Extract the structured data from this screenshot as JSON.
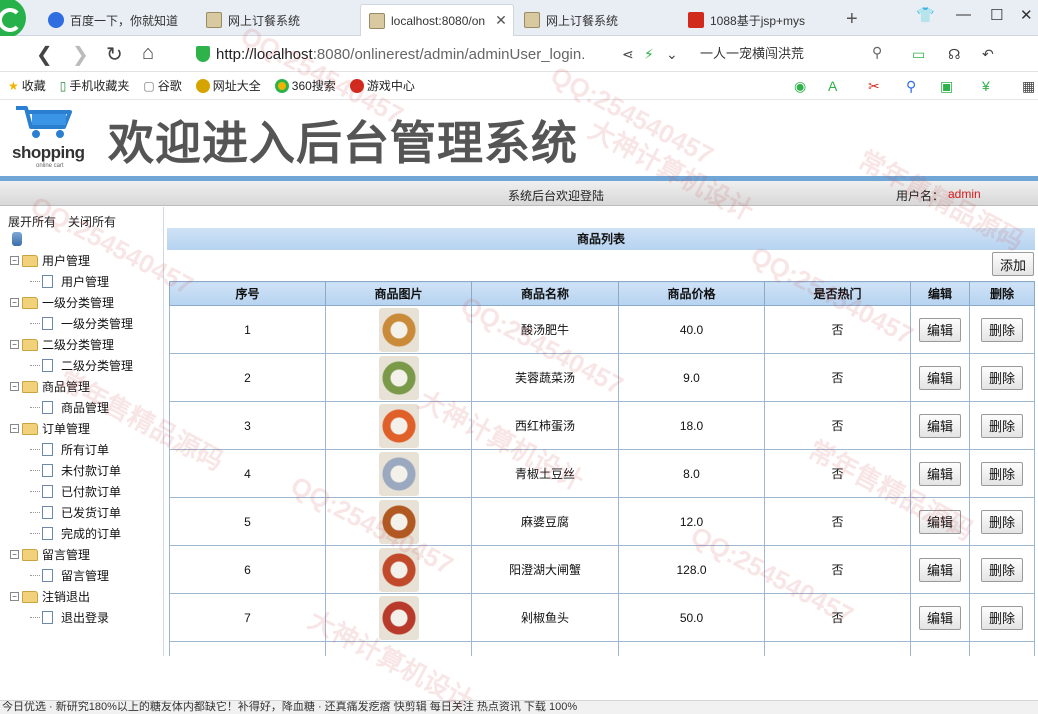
{
  "browser": {
    "tabs": [
      {
        "title": "百度一下，你就知道",
        "icon": "baidu-icon"
      },
      {
        "title": "网上订餐系统",
        "icon": "site-icon"
      },
      {
        "title": "localhost:8080/on",
        "icon": "site-icon",
        "active": true
      },
      {
        "title": "网上订餐系统",
        "icon": "site-icon"
      },
      {
        "title": "1088基于jsp+mys",
        "icon": "red-icon"
      }
    ],
    "url_host": "http://localhost",
    "url_rest": ":8080/onlinerest/admin/adminUser_login.",
    "search_text": "一人一宠横闯洪荒",
    "bookmarks": [
      "收藏",
      "手机收藏夹",
      "谷歌",
      "网址大全",
      "360搜索",
      "游戏中心"
    ]
  },
  "header": {
    "logo_text": "shopping",
    "logo_sub": "online cart",
    "title": "欢迎进入后台管理系统"
  },
  "welcome": {
    "text": "系统后台欢迎登陆",
    "user_label": "用户名：",
    "user_name": "admin"
  },
  "sidebar": {
    "expand_all": "展开所有",
    "collapse_all": "关闭所有",
    "groups": [
      {
        "label": "用户管理",
        "items": [
          "用户管理"
        ]
      },
      {
        "label": "一级分类管理",
        "items": [
          "一级分类管理"
        ]
      },
      {
        "label": "二级分类管理",
        "items": [
          "二级分类管理"
        ]
      },
      {
        "label": "商品管理",
        "items": [
          "商品管理"
        ]
      },
      {
        "label": "订单管理",
        "items": [
          "所有订单",
          "未付款订单",
          "已付款订单",
          "已发货订单",
          "完成的订单"
        ]
      },
      {
        "label": "留言管理",
        "items": [
          "留言管理"
        ]
      },
      {
        "label": "注销退出",
        "items": [
          "退出登录"
        ]
      }
    ]
  },
  "main": {
    "list_title": "商品列表",
    "add_label": "添加",
    "columns": [
      "序号",
      "商品图片",
      "商品名称",
      "商品价格",
      "是否热门",
      "编辑",
      "删除"
    ],
    "edit_label": "编辑",
    "delete_label": "删除",
    "rows": [
      {
        "no": "1",
        "name": "酸汤肥牛",
        "price": "40.0",
        "hot": "否",
        "img_color": "#c98a3a"
      },
      {
        "no": "2",
        "name": "芙蓉蔬菜汤",
        "price": "9.0",
        "hot": "否",
        "img_color": "#7a9a4a"
      },
      {
        "no": "3",
        "name": "西红柿蛋汤",
        "price": "18.0",
        "hot": "否",
        "img_color": "#e0602a"
      },
      {
        "no": "4",
        "name": "青椒土豆丝",
        "price": "8.0",
        "hot": "否",
        "img_color": "#9aa8c0"
      },
      {
        "no": "5",
        "name": "麻婆豆腐",
        "price": "12.0",
        "hot": "否",
        "img_color": "#b05a22"
      },
      {
        "no": "6",
        "name": "阳澄湖大闸蟹",
        "price": "128.0",
        "hot": "否",
        "img_color": "#c04a2a"
      },
      {
        "no": "7",
        "name": "剁椒鱼头",
        "price": "50.0",
        "hot": "否",
        "img_color": "#b83a2a"
      }
    ]
  },
  "statusbar": {
    "text": "今日优选   ·   新研究180%以上的糖友体内都缺它！补得好，降血糖  ·  还真痛发疙瘩   快剪辑   每日关注   热点资讯          下载              100%"
  },
  "watermarks": [
    "QQ:254540457",
    "大神计算机设计",
    "常年售精品源码"
  ]
}
